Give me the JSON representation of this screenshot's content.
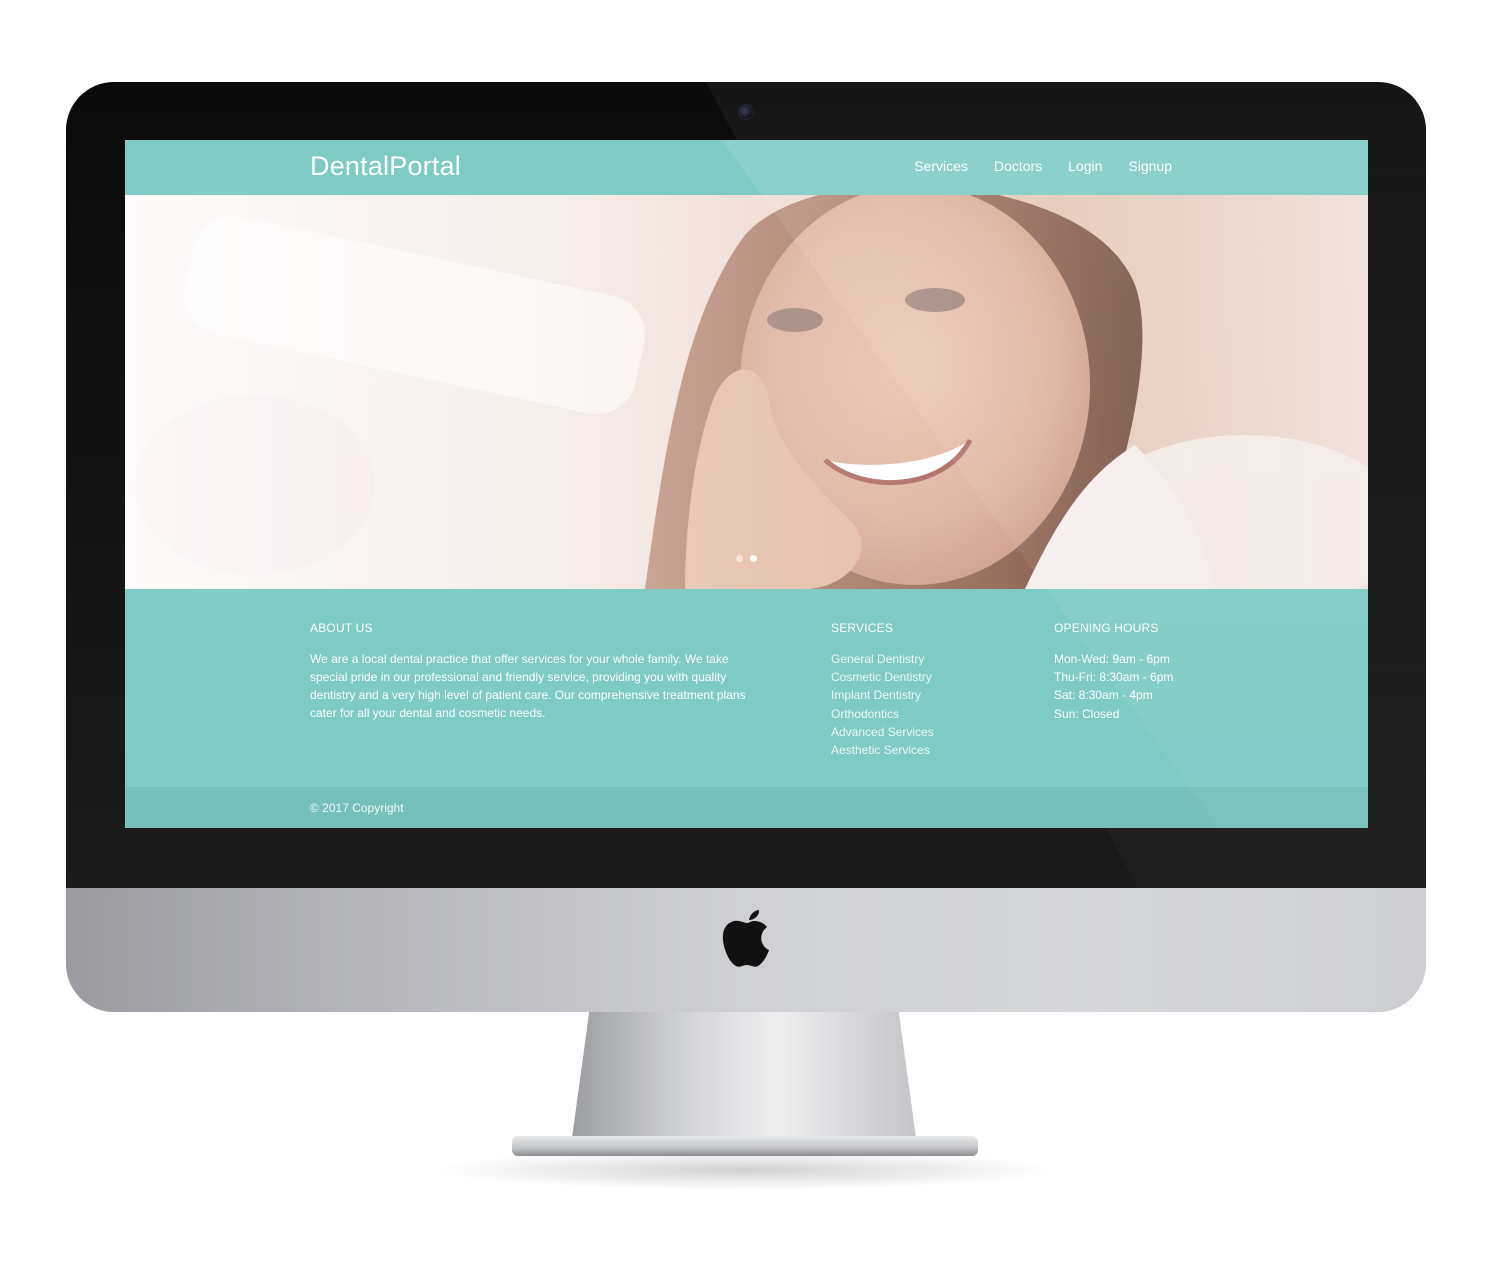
{
  "site": {
    "brand": "DentalPortal",
    "nav": [
      "Services",
      "Doctors",
      "Login",
      "Signup"
    ]
  },
  "hero": {
    "slides": 2,
    "active_slide": 2
  },
  "about": {
    "heading": "ABOUT US",
    "text": "We are a local dental practice that offer services for your whole family. We take special pride in our professional and friendly service, providing you with quality dentistry and a very high level of patient care. Our comprehensive treatment plans cater for all your dental and cosmetic needs."
  },
  "services": {
    "heading": "SERVICES",
    "items": [
      "General Dentistry",
      "Cosmetic Dentistry",
      "Implant Dentistry",
      "Orthodontics",
      "Advanced Services",
      "Aesthetic Services"
    ]
  },
  "hours": {
    "heading": "OPENING HOURS",
    "items": [
      "Mon-Wed: 9am - 6pm",
      "Thu-Fri: 8:30am - 6pm",
      "Sat: 8:30am - 4pm",
      "Sun: Closed"
    ]
  },
  "footer": {
    "copyright": "© 2017 Copyright"
  },
  "colors": {
    "accent": "#7ecbc3",
    "footer_bar": "#75c0b8",
    "text": "#ffffff"
  },
  "icons": [
    "apple-logo-icon",
    "camera-icon"
  ]
}
